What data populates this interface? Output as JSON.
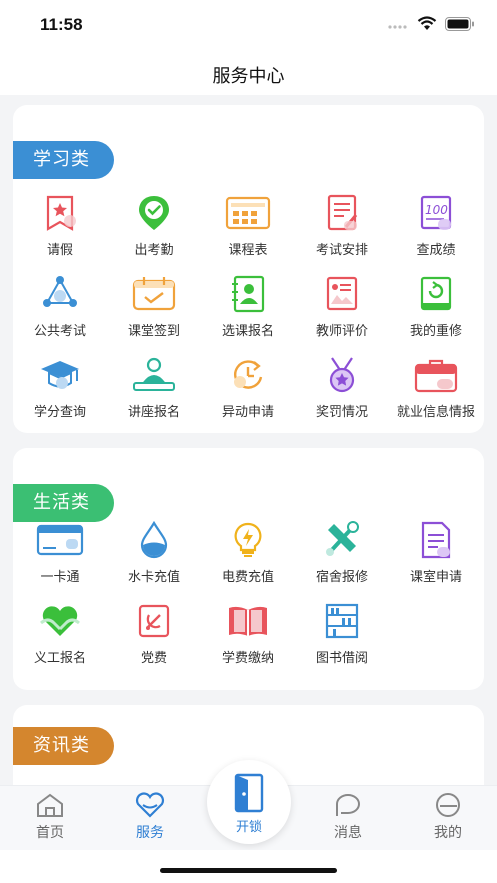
{
  "status": {
    "time": "11:58"
  },
  "header": {
    "title": "服务中心"
  },
  "sections": [
    {
      "tag": "学习类",
      "color": "#3b8fd4",
      "items": [
        {
          "label": "请假",
          "icon": "leave-icon"
        },
        {
          "label": "出考勤",
          "icon": "attendance-icon"
        },
        {
          "label": "课程表",
          "icon": "timetable-icon"
        },
        {
          "label": "考试安排",
          "icon": "exam-schedule-icon"
        },
        {
          "label": "查成绩",
          "icon": "grades-icon"
        },
        {
          "label": "公共考试",
          "icon": "public-exam-icon"
        },
        {
          "label": "课堂签到",
          "icon": "class-checkin-icon"
        },
        {
          "label": "选课报名",
          "icon": "course-signup-icon"
        },
        {
          "label": "教师评价",
          "icon": "teacher-review-icon"
        },
        {
          "label": "我的重修",
          "icon": "retake-icon"
        },
        {
          "label": "学分查询",
          "icon": "credits-icon"
        },
        {
          "label": "讲座报名",
          "icon": "lecture-icon"
        },
        {
          "label": "异动申请",
          "icon": "status-change-icon"
        },
        {
          "label": "奖罚情况",
          "icon": "award-icon"
        },
        {
          "label": "就业信息情报",
          "icon": "employment-icon"
        }
      ]
    },
    {
      "tag": "生活类",
      "color": "#3bbf73",
      "items": [
        {
          "label": "一卡通",
          "icon": "campus-card-icon"
        },
        {
          "label": "水卡充值",
          "icon": "water-icon"
        },
        {
          "label": "电费充值",
          "icon": "electricity-icon"
        },
        {
          "label": "宿舍报修",
          "icon": "repair-icon"
        },
        {
          "label": "课室申请",
          "icon": "classroom-apply-icon"
        },
        {
          "label": "义工报名",
          "icon": "volunteer-icon"
        },
        {
          "label": "党费",
          "icon": "party-fee-icon"
        },
        {
          "label": "学费缴纳",
          "icon": "tuition-icon"
        },
        {
          "label": "图书借阅",
          "icon": "library-icon"
        }
      ]
    },
    {
      "tag": "资讯类",
      "color": "#d4862e",
      "items": []
    }
  ],
  "tabbar": {
    "items": [
      {
        "label": "首页",
        "icon": "home-icon"
      },
      {
        "label": "服务",
        "icon": "service-heart-icon"
      },
      {
        "label": "消息",
        "icon": "message-icon"
      },
      {
        "label": "我的",
        "icon": "profile-icon"
      }
    ],
    "center": {
      "label": "开锁",
      "icon": "door-unlock-icon"
    },
    "active_index": 1
  }
}
